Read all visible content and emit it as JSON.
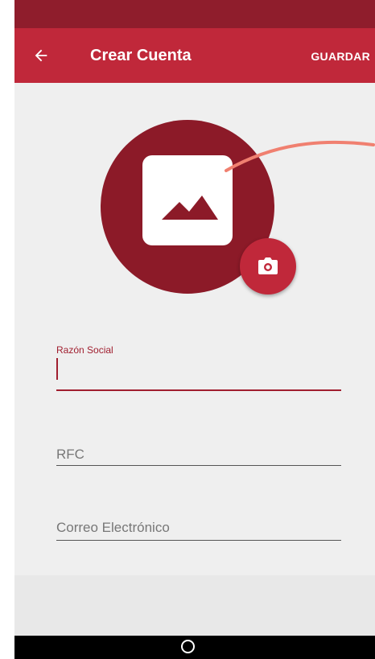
{
  "app_bar": {
    "title": "Crear Cuenta",
    "save_label": "GUARDAR",
    "back_icon": "arrow-left-icon"
  },
  "profile": {
    "placeholder_icon": "image-icon",
    "camera_icon": "camera-icon"
  },
  "form": {
    "razon_social": {
      "label": "Razón Social",
      "value": ""
    },
    "rfc": {
      "placeholder": "RFC"
    },
    "email": {
      "placeholder": "Correo Electrónico"
    }
  },
  "colors": {
    "primary": "#c0283a",
    "primary_dark": "#8f1d2c",
    "avatar": "#8c1a28",
    "accent_line": "#a01e2f"
  }
}
